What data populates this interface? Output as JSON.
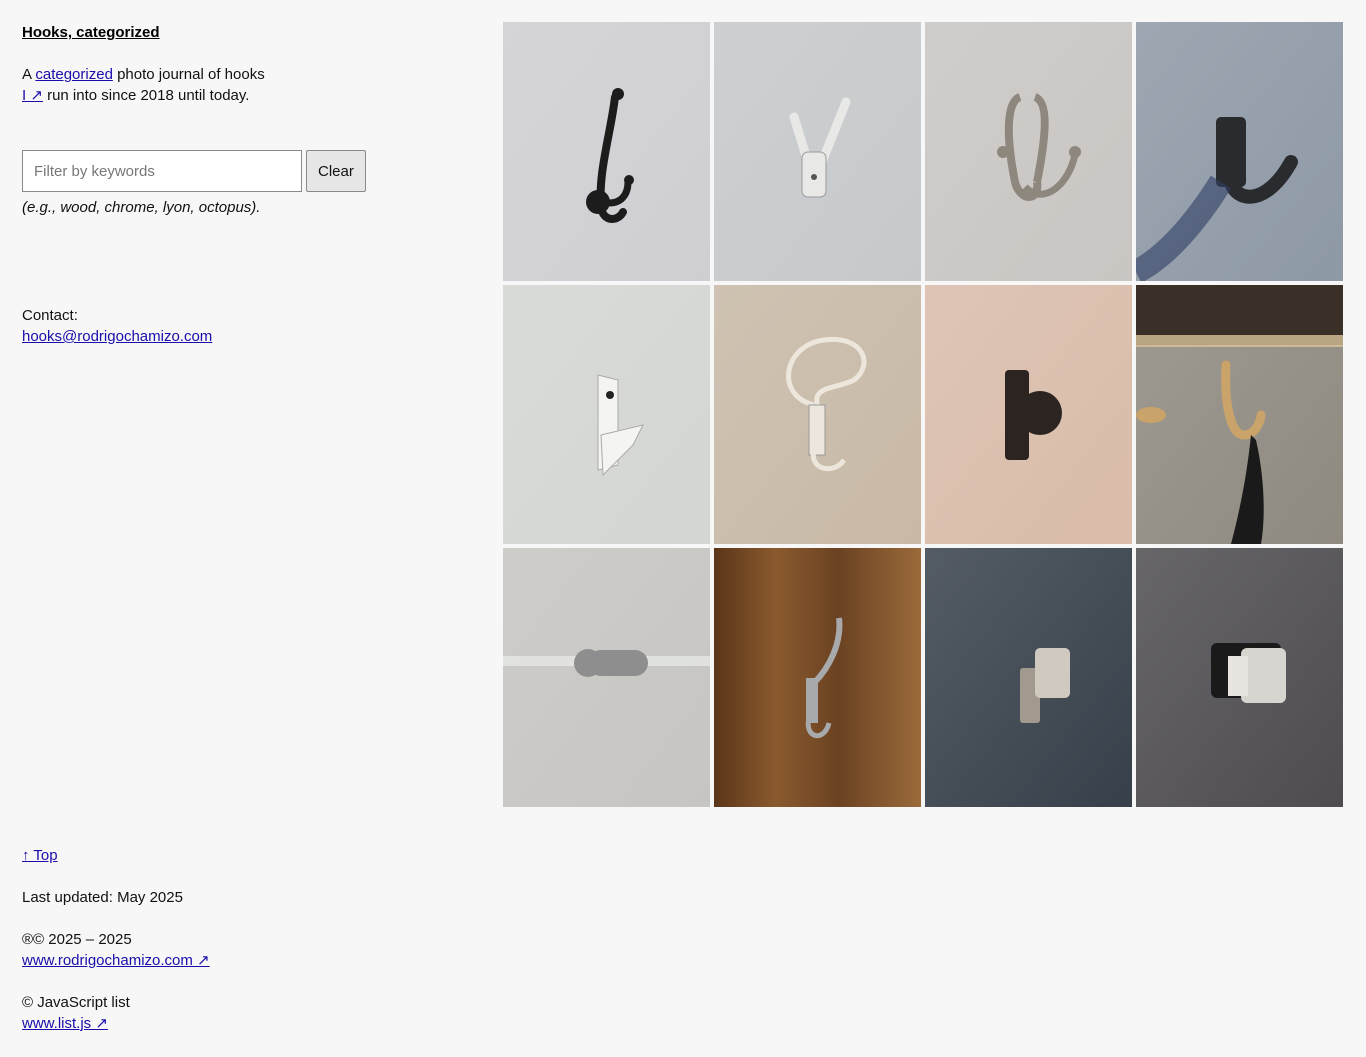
{
  "site": {
    "title": "Hooks, categorized",
    "intro_prefix": "A ",
    "intro_link": "categorized",
    "intro_middle": " photo journal of hooks",
    "intro_author_link": "I ↗",
    "intro_suffix": " run into since 2018 until today."
  },
  "filter": {
    "placeholder": "Filter by keywords",
    "value": "",
    "clear_label": "Clear",
    "hint": "(e.g., wood, chrome, lyon, octopus)."
  },
  "contact": {
    "label": "Contact:",
    "email": "hooks@rodrigochamizo.com"
  },
  "gallery": {
    "photos": [
      {
        "icon": "black-double-hook-photo",
        "bg": "#cfcfd3",
        "hook": "#1c1c1c"
      },
      {
        "icon": "white-v-hook-photo",
        "bg": "#c6c9cb",
        "hook": "#e8e8e6"
      },
      {
        "icon": "nickel-double-hook-photo",
        "bg": "#c9c5c2",
        "hook": "#8d877e"
      },
      {
        "icon": "black-angled-hook-photo",
        "bg": "#8e99a6",
        "hook": "#2a2b2e"
      },
      {
        "icon": "white-plastic-hook-photo",
        "bg": "#d3d6d3",
        "hook": "#f4f4f2"
      },
      {
        "icon": "white-wire-hook-photo",
        "bg": "#c8b9a6",
        "hook": "#ece6dc"
      },
      {
        "icon": "black-knob-hook-photo",
        "bg": "#d9bca9",
        "hook": "#2b2420"
      },
      {
        "icon": "brass-under-shelf-hook-photo",
        "bg": "#8f8a80",
        "hook": "#c9a36a"
      },
      {
        "icon": "steel-glass-hook-photo",
        "bg": "#c7c5c1",
        "hook": "#8e8e8e"
      },
      {
        "icon": "chrome-hook-on-wood-door-photo",
        "bg": "#6f4526",
        "hook": "#a8a9ab"
      },
      {
        "icon": "square-steel-hook-dark-wall-photo",
        "bg": "#37404a",
        "hook": "#cfc9c0"
      },
      {
        "icon": "square-chrome-hook-dark-wall-photo",
        "bg": "#4e4c50",
        "hook": "#d8d4d0"
      }
    ]
  },
  "footer": {
    "top_link": "↑ Top",
    "updated": "Last updated: May 2025",
    "copyright_line": "®© 2025 – 2025",
    "site_link": "www.rodrigochamizo.com ↗",
    "js_line": "© JavaScript list",
    "js_link": "www.list.js ↗"
  }
}
